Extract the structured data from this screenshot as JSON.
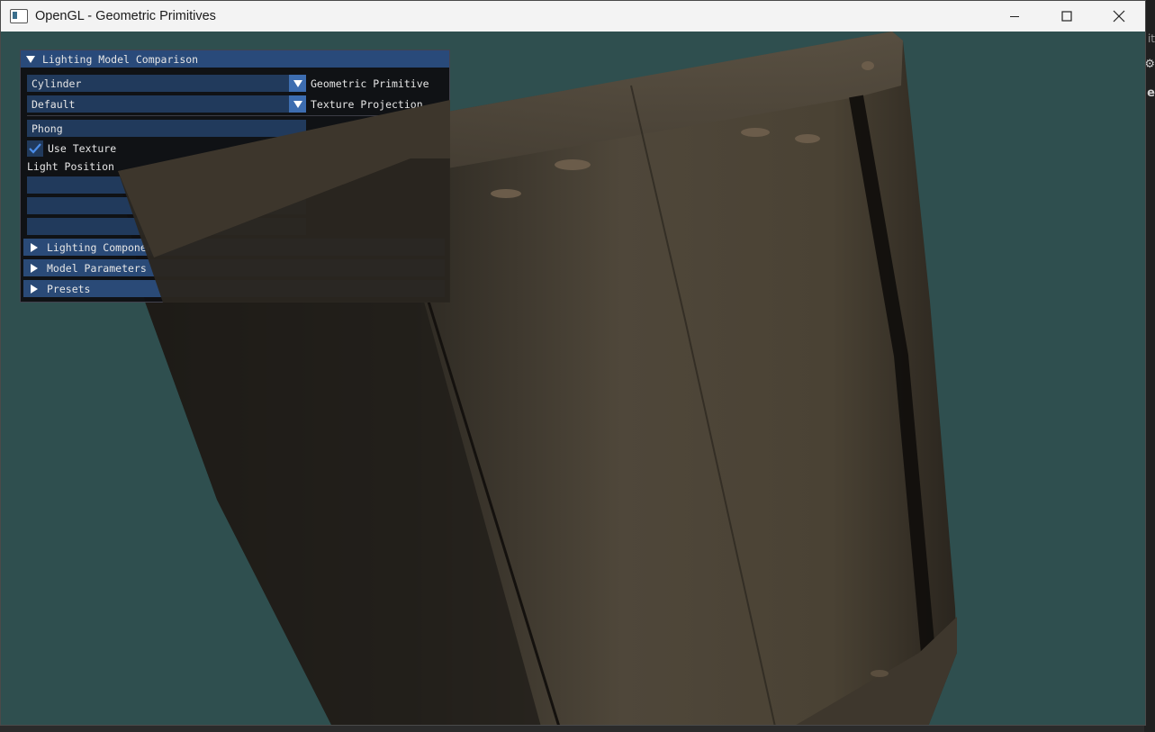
{
  "window": {
    "title": "OpenGL - Geometric Primitives",
    "icon": "opengl-app-icon",
    "controls": [
      "minimize-icon",
      "maximize-icon",
      "close-icon"
    ]
  },
  "background_app": {
    "fragments": [
      "it",
      "e"
    ],
    "gear": "gear-icon"
  },
  "colors": {
    "clear": "#2f4f4f",
    "panel_title": "#294a7a",
    "frame": "#213a5c",
    "accent": "#3d6db0",
    "wood": "#4a4234"
  },
  "panel": {
    "title": "Lighting Model Comparison",
    "primitive": {
      "value": "Cylinder",
      "label": "Geometric Primitive"
    },
    "projection": {
      "value": "Default",
      "label": "Texture Projection"
    },
    "lighting_model": {
      "value": "Phong"
    },
    "use_texture": {
      "label": "Use Texture",
      "checked": true
    },
    "light_position_label": "Light Position",
    "sections": [
      {
        "label": "Lighting Components"
      },
      {
        "label": "Model Parameters"
      },
      {
        "label": "Presets"
      }
    ]
  }
}
